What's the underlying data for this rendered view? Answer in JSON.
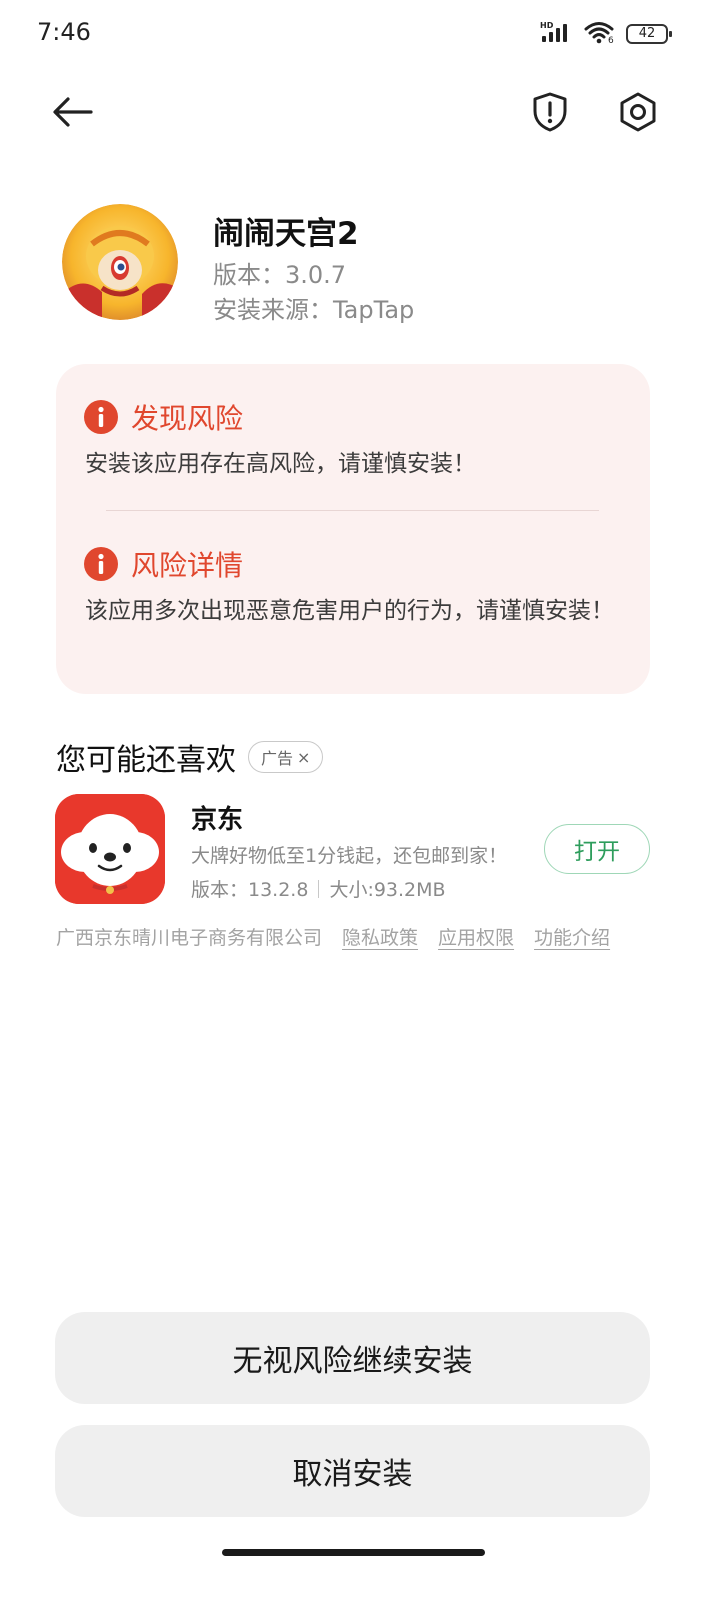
{
  "status_bar": {
    "time": "7:46",
    "network_label": "HD",
    "wifi_label": "6",
    "battery": "42"
  },
  "top_bar": {
    "back_icon": "arrow-left-icon",
    "actions": [
      {
        "icon": "shield-alert-icon"
      },
      {
        "icon": "settings-icon"
      }
    ]
  },
  "app": {
    "name": "闹闹天宫2",
    "version": "版本：3.0.7",
    "source": "安装来源：TapTap",
    "icon": "monkey-king-app-icon"
  },
  "risk": {
    "accent_color": "#e0472e",
    "card_color": "#fcf1f0",
    "found_title": "发现风险",
    "found_text": "安装该应用存在高风险，请谨慎安装！",
    "details_title": "风险详情",
    "details_text": "该应用多次出现恶意危害用户的行为，请谨慎安装！"
  },
  "recommend": {
    "title": "您可能还喜欢",
    "ad_label": "广告",
    "ad_close": "×",
    "item": {
      "name": "京东",
      "description": "大牌好物低至1分钱起，还包邮到家！",
      "version": "版本：13.2.8",
      "size": "大小:93.2MB",
      "open_label": "打开",
      "icon": "jd-app-icon",
      "brand_color": "#e8382c"
    },
    "developer": "广西京东晴川电子商务有限公司",
    "links": [
      "隐私政策",
      "应用权限",
      "功能介绍"
    ]
  },
  "buttons": {
    "continue_label": "无视风险继续安装",
    "cancel_label": "取消安装"
  }
}
